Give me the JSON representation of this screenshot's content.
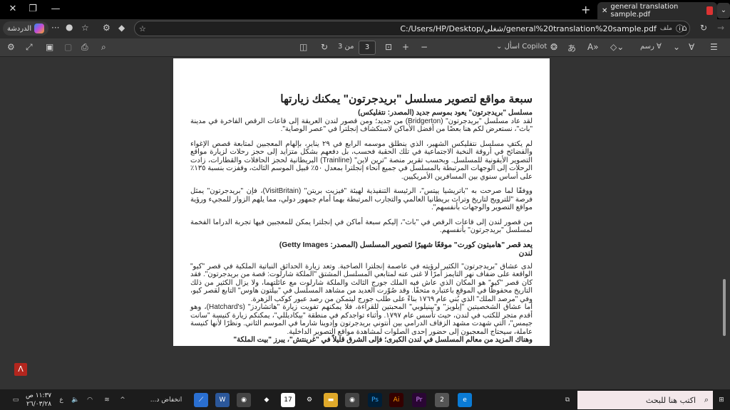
{
  "tab": {
    "title": "general translation sample.pdf"
  },
  "address": {
    "url": "C:/Users/HP/Desktop/شغلي/general%20translation%20sample.pdf",
    "file_label": "ملف",
    "chat_label": "الدردشة"
  },
  "pdf_toolbar": {
    "current_page": "3",
    "of_pages": "من 3",
    "ask_copilot": "اسأل Copilot",
    "draw": "رسم"
  },
  "document": {
    "title": "سبعة مواقع لتصوير مسلسل \"بريدجرتون\" يمكنك زيارتها",
    "caption1": "مسلسل \"بريدجرتون\" يعود بموسم جديد (المصدر: نتفليكس)",
    "p1": "لقد عاد مسلسل \"بريدجرتون\" (Bridgerton) من جديد؛ ومن قصور لندن العريقة إلى قاعات الرقص الفاخرة في مدينة \"باث\"، نستعرض لكم هنا بعضًا من أفضل الأماكن لاستكشاف إنجلترا في \"عصر الوصاية\".",
    "p2": "لم يكتفِ مسلسل نتفليكس الشهير، الذي ينطلق موسمه الرابع في ٢٩ يناير، بإلهام المعجبين لمتابعة قصص الإغواء والفضائح في أروقة النخبة الاجتماعية في تلك الحقبة فحسب، بل دفعهم بشكل متزايد إلى حجز رحلات لزيارة مواقع التصوير الأيقونية للمسلسل. وبحسب تقرير منصة \"ترين لاين\" (Trainline) البريطانية لحجز الحافلات والقطارات، زادت الرحلات إلى الوجهات المرتبطة بالمسلسل في جميع أنحاء إنجلترا بمعدل ٥٠٪ قبيل الموسم الثالث، وقفزت بنسبة ١٣٥٪ على أساس سنوي بين المسافرين الأمريكيين.",
    "p3": "ووفقًا لما صرحت به \"باتريشيا ييتس\"، الرئيسة التنفيذية لهيئة \"فيزيت بريتن\" (VisitBritain)، فإن \"بريدجرتون\" يمثل فرصة \"للترويج لتاريخ وتراث بريطانيا العالمي والتجارب المرتبطة بهما أمام جمهور دولي، مما يلهم الزوار للمجيء ورؤية مواقع التصوير والوجهات بأنفسهم\".",
    "p4": "من قصور لندن إلى قاعات الرقص في \"باث\"، إليكم سبعة أماكن في إنجلترا يمكن للمعجبين فيها تجربة الدراما الفخمة لمسلسل \"بريدجرتون\" بأنفسهم.",
    "caption2": "يعد قصر \"هامبتون كورت\" موقعًا شهيرًا لتصوير المسلسل (المصدر: Getty Images)",
    "heading2": "لندن",
    "p5": "لدى عشاق \"بريدجرتون\" الكثير لرؤيته في عاصمة إنجلترا الصاخبة. وتعد زيارة الحدائق النباتية الملكية في قصر \"كيو\" الواقعة على ضفاف نهر التايمز أمرًا لا غنى عنه لمتابعي المسلسل المشتق \"الملكة شارلوت: قصة من بريدجرتون\". فقد كان قصر \"كيو\" هو المكان الذي عاش فيه الملك جورج الثالث والملكة شارلوت مع عائلتهما، ولا يزال الكثير من ذلك التاريخ محفوظًا في الموقع باعتباره متحفًا. وقد صُوّرت العديد من مشاهد المسلسل في \"بيلتون هاوس\" التابع لقصر كيو، وفي \"مرصد الملك\" الذي بُني عام ١٧٦٩ بناءً على طلب جورج ليتمكن من رصد عبور كوكب الزهرة.",
    "p6": "أما عشاق الشخصيتين \"إيلويز\" و\"بينيلوبي\" المحبتين للقراءة، فلا يمكنهم تفويت زيارة \"هاتشاردز\" (Hatchard's)، وهو أقدم متجر للكتب في لندن، حيث تأسس عام ١٧٩٧. وأثناء تواجدكم في منطقة \"بيكاديللي\"، يمكنكم زيارة كنيسة \"سانت جيمس\"، التي شهدت مشهد الزفاف الدرامي بين أنتوني بريدجرتون وإدوينا شارما في الموسم الثاني. ونظرًا لأنها كنيسة عاملة، سيحتاج المعجبون إلى حضور إحدى الصلوات لمشاهدة مواقع التصوير الداخلية.",
    "p7": "وهناك المزيد من معالم المسلسل في لندن الكبرى؛ فإلى الشرق قليلاً في \"غرينتش\"، يبرز \"بيت الملكة\""
  },
  "taskbar": {
    "search_placeholder": "اكتب هنا للبحث",
    "weather": "انخفاض د...",
    "time": "١١:٣٧ ص",
    "date": "٢٦/٠٣/٢٨",
    "lang": "ع"
  }
}
